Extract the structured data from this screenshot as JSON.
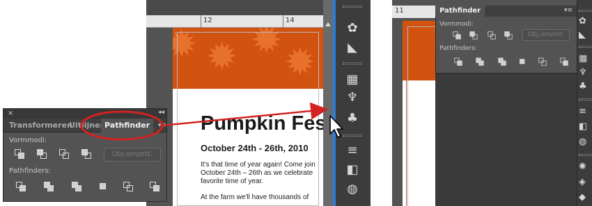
{
  "left_panel": {
    "close_glyph": "×",
    "collapse_glyph": "◂◂",
    "tabs": [
      {
        "label": "Transformeren",
        "active": false
      },
      {
        "label": "Uitlijnen",
        "active": false
      },
      {
        "label": "Pathfinder",
        "active": true
      }
    ],
    "menu_glyph": "▾≡",
    "shape_modes_label": "Vormmodi:",
    "expand_button_label": "Obj.omzett.",
    "pathfinders_label": "Pathfinders:"
  },
  "middle": {
    "ruler_labels": [
      "12",
      "14"
    ],
    "title": "Pumpkin Fest",
    "date": "October 24th - 26th, 2010",
    "paragraph_1": "It's that time of year again! Come join October 24th – 26th as we celebrate favorite time of year.",
    "paragraph_2": "At the farm we'll have thousands of"
  },
  "right_panel": {
    "ruler_label": "11",
    "tab_label": "Pathfinder",
    "menu_glyph": "▾≡",
    "shape_modes_label": "Vormmodi:",
    "expand_button_label": "Obj.omzett.",
    "pathfinders_label": "Pathfinders:"
  },
  "colors": {
    "accent_blue": "#2b7dd9",
    "callout_red": "#d42121",
    "panel_bg": "#535353",
    "leaf_orange": "#d2520f"
  }
}
